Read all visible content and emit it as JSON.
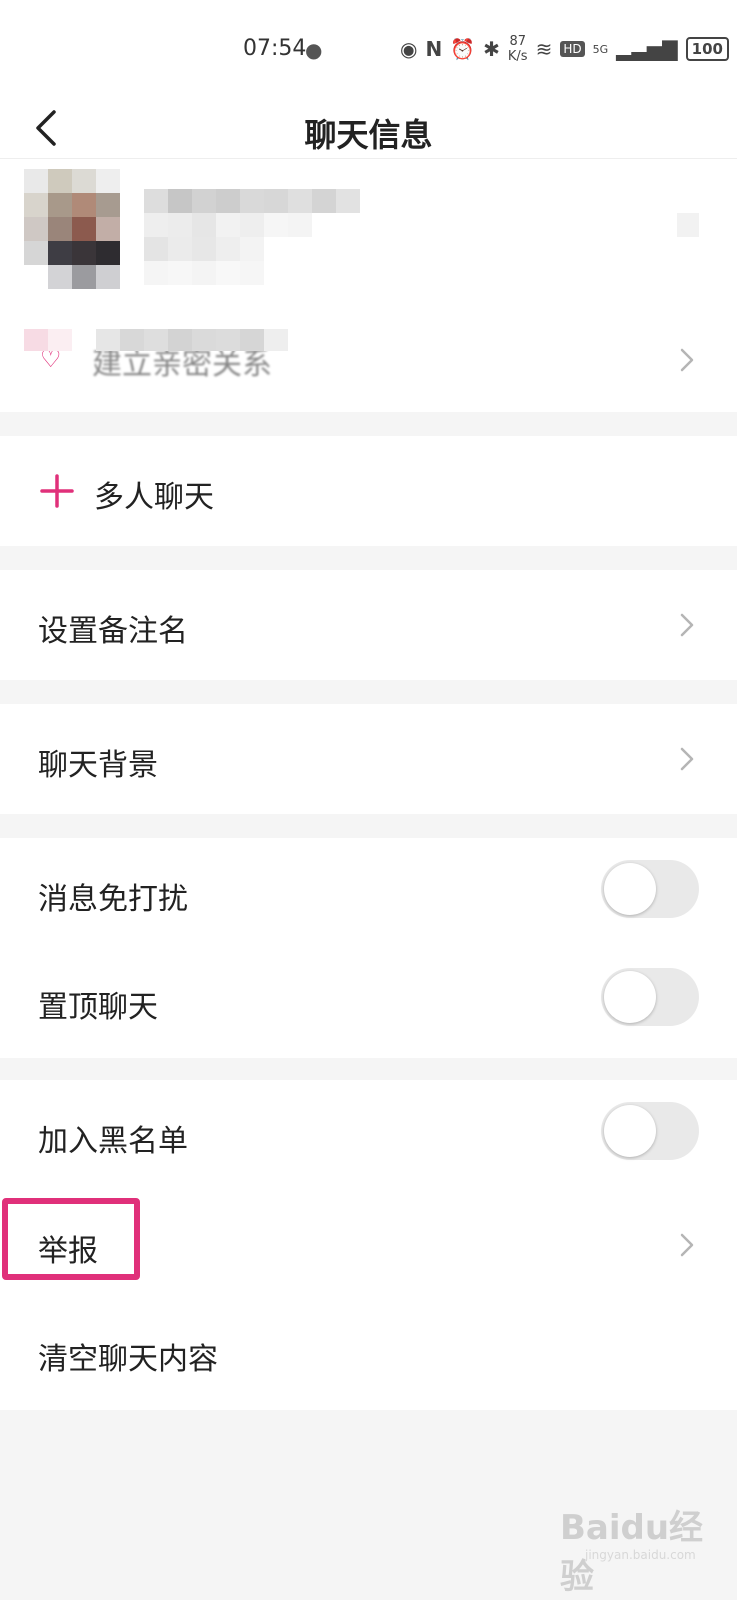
{
  "status_bar": {
    "time": "07:54",
    "speed_value": "87",
    "speed_unit": "K/s",
    "hd": "HD",
    "network": "5G",
    "battery": "100"
  },
  "header": {
    "title": "聊天信息"
  },
  "profile": {
    "intimacy_label": "建立亲密关系"
  },
  "group_chat": {
    "label": "多人聊天",
    "accent_color": "#e0307a"
  },
  "settings": {
    "remark_label": "设置备注名",
    "background_label": "聊天背景",
    "dnd_label": "消息免打扰",
    "dnd_on": false,
    "pin_label": "置顶聊天",
    "pin_on": false,
    "blacklist_label": "加入黑名单",
    "blacklist_on": false,
    "report_label": "举报",
    "clear_label": "清空聊天内容"
  },
  "watermark": {
    "brand": "Baidu经验",
    "url": "jingyan.baidu.com"
  }
}
